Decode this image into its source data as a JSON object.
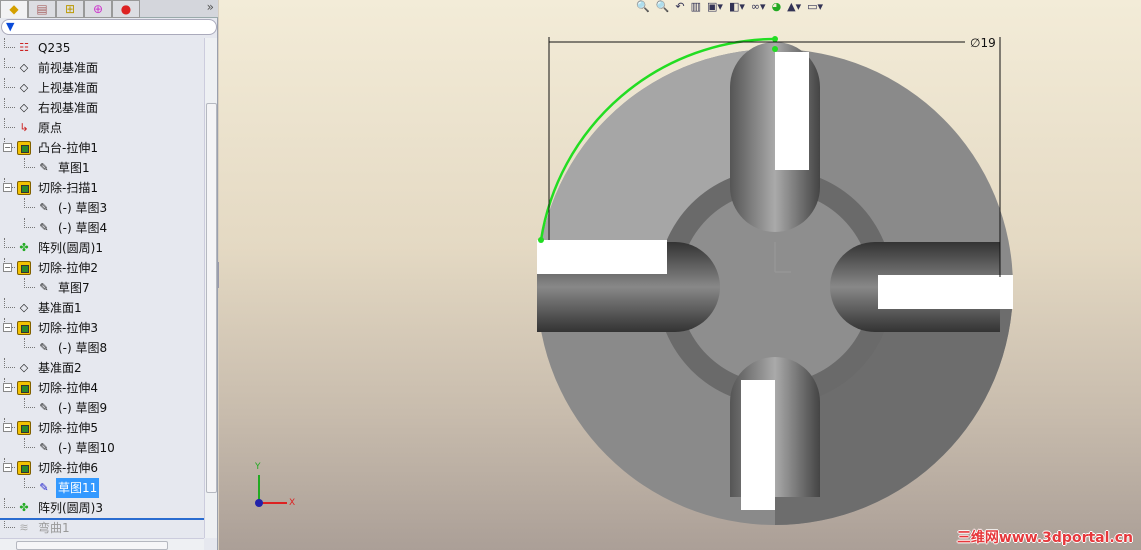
{
  "panel": {
    "tabs": [
      {
        "name": "feature-manager-tab",
        "icon": "feature-tree-icon"
      },
      {
        "name": "property-manager-tab",
        "icon": "property-icon"
      },
      {
        "name": "configuration-manager-tab",
        "icon": "config-icon"
      },
      {
        "name": "dimxpert-tab",
        "icon": "crosshair-icon"
      },
      {
        "name": "display-manager-tab",
        "icon": "appearance-icon"
      }
    ],
    "more": "»",
    "filter": "▼",
    "tree": [
      {
        "label": "Q235",
        "icon": "material",
        "level": 0
      },
      {
        "label": "前视基准面",
        "icon": "plane",
        "level": 0
      },
      {
        "label": "上视基准面",
        "icon": "plane",
        "level": 0
      },
      {
        "label": "右视基准面",
        "icon": "plane",
        "level": 0
      },
      {
        "label": "原点",
        "icon": "origin",
        "level": 0
      },
      {
        "label": "凸台-拉伸1",
        "icon": "boss",
        "level": 0,
        "expand": true
      },
      {
        "label": "草图1",
        "icon": "sketch",
        "level": 1
      },
      {
        "label": "切除-扫描1",
        "icon": "sweep",
        "level": 0,
        "expand": true
      },
      {
        "label": "(-) 草图3",
        "icon": "sketch",
        "level": 1
      },
      {
        "label": "(-) 草图4",
        "icon": "sketch",
        "level": 1
      },
      {
        "label": "阵列(圆周)1",
        "icon": "pattern",
        "level": 0
      },
      {
        "label": "切除-拉伸2",
        "icon": "cut",
        "level": 0,
        "expand": true
      },
      {
        "label": "草图7",
        "icon": "sketch",
        "level": 1
      },
      {
        "label": "基准面1",
        "icon": "plane",
        "level": 0
      },
      {
        "label": "切除-拉伸3",
        "icon": "cut",
        "level": 0,
        "expand": true
      },
      {
        "label": "(-) 草图8",
        "icon": "sketch",
        "level": 1
      },
      {
        "label": "基准面2",
        "icon": "plane",
        "level": 0
      },
      {
        "label": "切除-拉伸4",
        "icon": "cut",
        "level": 0,
        "expand": true
      },
      {
        "label": "(-) 草图9",
        "icon": "sketch",
        "level": 1
      },
      {
        "label": "切除-拉伸5",
        "icon": "cut",
        "level": 0,
        "expand": true
      },
      {
        "label": "(-) 草图10",
        "icon": "sketch",
        "level": 1
      },
      {
        "label": "切除-拉伸6",
        "icon": "cut",
        "level": 0,
        "expand": true
      },
      {
        "label": "草图11",
        "icon": "sketch",
        "level": 1,
        "selected": true
      },
      {
        "label": "阵列(圆周)3",
        "icon": "pattern",
        "level": 0
      },
      {
        "label": "弯曲1",
        "icon": "flex",
        "level": 0,
        "dim": true
      }
    ]
  },
  "toolbar": [
    "zoom-to-fit-icon",
    "zoom-area-icon",
    "previous-view-icon",
    "section-view-icon",
    "view-orientation-icon",
    "display-style-icon",
    "hide-show-icon",
    "appearance-icon",
    "scene-icon",
    "view-settings-icon"
  ],
  "viewport": {
    "dimension": "∅19",
    "axis_x": "X",
    "axis_y": "Y",
    "watermark": "三维网www.3dportal.cn"
  }
}
